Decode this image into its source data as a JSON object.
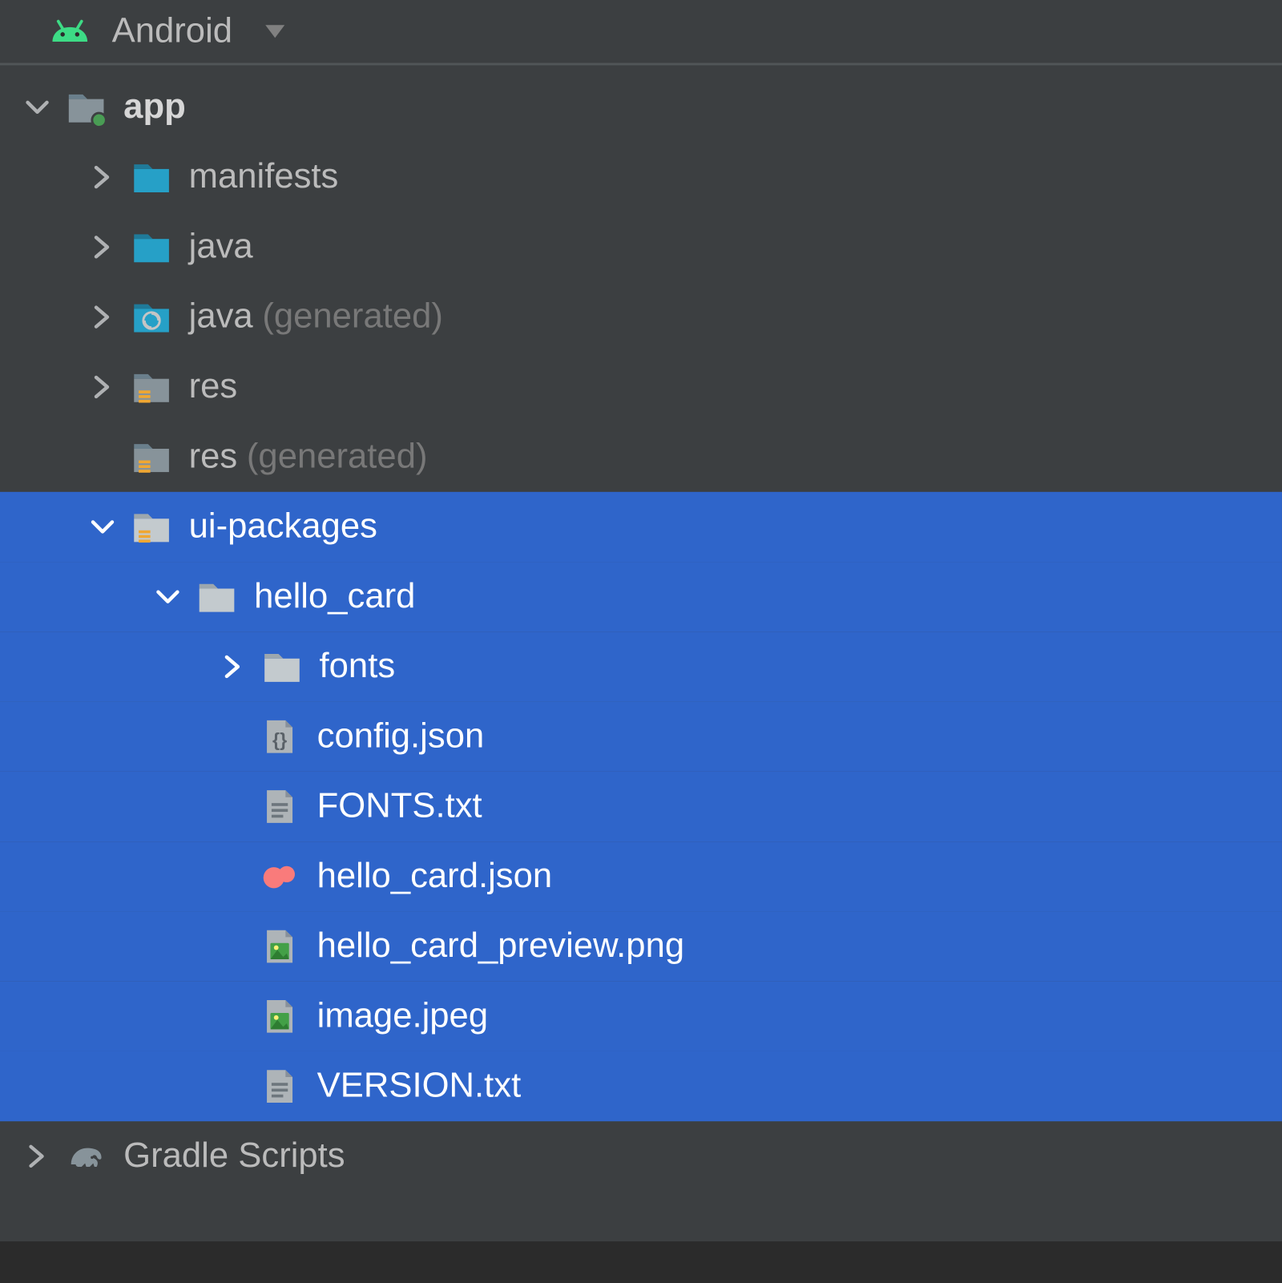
{
  "header": {
    "title": "Android"
  },
  "tree": {
    "app": {
      "label": "app"
    },
    "manifests": {
      "label": "manifests"
    },
    "java": {
      "label": "java"
    },
    "java_gen": {
      "label": "java",
      "hint": "(generated)"
    },
    "res": {
      "label": "res"
    },
    "res_gen": {
      "label": "res",
      "hint": "(generated)"
    },
    "ui_packages": {
      "label": "ui-packages"
    },
    "hello_card": {
      "label": "hello_card"
    },
    "fonts": {
      "label": "fonts"
    },
    "config_json": {
      "label": "config.json"
    },
    "fonts_txt": {
      "label": "FONTS.txt"
    },
    "hello_card_json": {
      "label": "hello_card.json"
    },
    "hello_card_preview": {
      "label": "hello_card_preview.png"
    },
    "image_jpeg": {
      "label": "image.jpeg"
    },
    "version_txt": {
      "label": "VERSION.txt"
    },
    "gradle": {
      "label": "Gradle Scripts"
    }
  }
}
